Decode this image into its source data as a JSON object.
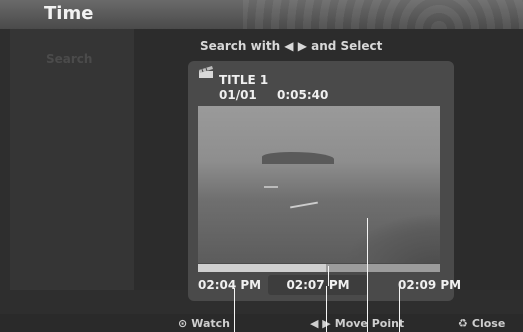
{
  "window": {
    "title": "Time"
  },
  "sidebar": {
    "items": [
      {
        "label": "Search"
      }
    ]
  },
  "main": {
    "instruction": "Search with ◀ ▶ and Select",
    "title_name": "TITLE 1",
    "title_index": "01/01",
    "title_duration": "0:05:40",
    "progress_fraction": 0.53,
    "times": {
      "left": "02:04 PM",
      "middle": "02:07 PM",
      "right": "02:09 PM"
    }
  },
  "footer": {
    "watch": {
      "symbol": "⊙",
      "label": "Watch"
    },
    "move": {
      "symbol": "◀ ▶",
      "label": "Move Point"
    },
    "close": {
      "symbol": "♻",
      "label": "Close"
    }
  },
  "icons": {
    "title": "clapperboard-icon"
  }
}
